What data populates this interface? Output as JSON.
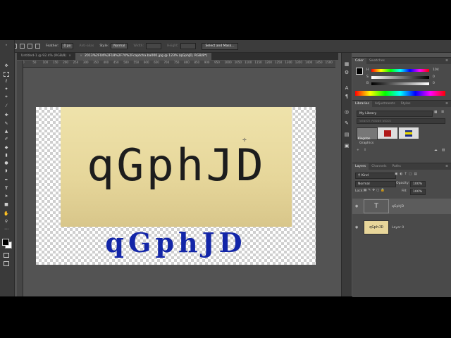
{
  "options_bar": {
    "feather_label": "Feather:",
    "feather_value": "0 px",
    "antialias_label": "Anti-alias",
    "style_label": "Style:",
    "style_value": "Normal",
    "width_label": "Width:",
    "height_label": "Height:",
    "select_mask_button": "Select and Mask..."
  },
  "tabs": [
    {
      "label": "Untitled-1 @ 92.4% (RGB/8)",
      "active": false
    },
    {
      "label": "2013%2F04%2F18%2F70%2Fcaptcha.ba000.jpg @ 123% (qGphJD, RGB/8*)",
      "active": true
    }
  ],
  "ruler": {
    "marks": [
      "0",
      "50",
      "100",
      "150",
      "200",
      "250",
      "300",
      "350",
      "400",
      "450",
      "500",
      "550",
      "600",
      "650",
      "700",
      "750",
      "800",
      "850",
      "900",
      "950",
      "1000",
      "1050",
      "1100",
      "1150",
      "1200",
      "1250",
      "1300",
      "1350",
      "1400",
      "1450",
      "1500"
    ]
  },
  "canvas": {
    "photo_text": "qGphJD",
    "typed_text": "qGphJD",
    "typed_color": "#1326a8"
  },
  "color_panel": {
    "tabs": [
      "Color",
      "Swatches"
    ],
    "h_label": "H",
    "h_value": "104",
    "s_label": "S",
    "s_value": "0",
    "b_label": "B",
    "b_value": "0"
  },
  "libraries_panel": {
    "tabs": [
      "Libraries",
      "Adjustments",
      "Styles"
    ],
    "library_select": "My Library",
    "search_placeholder": "Search Adobe Stock",
    "item_label": "Kingston",
    "graphics_label": "Graphics"
  },
  "layers_panel": {
    "tabs": [
      "Layers",
      "Channels",
      "Paths"
    ],
    "kind_label": "Kind",
    "blend_mode": "Normal",
    "opacity_label": "Opacity:",
    "opacity_value": "100%",
    "lock_label": "Lock:",
    "fill_label": "Fill:",
    "fill_value": "100%",
    "layers": [
      {
        "name": "qGphJD",
        "type": "text",
        "thumb": "T"
      },
      {
        "name": "Layer 0",
        "type": "image",
        "thumb": "qGphJD"
      }
    ]
  },
  "toolbar": {
    "tools": [
      "move-tool",
      "marquee-tool",
      "lasso-tool",
      "magic-wand-tool",
      "crop-tool",
      "eyedropper-tool",
      "healing-tool",
      "brush-tool",
      "stamp-tool",
      "history-brush-tool",
      "eraser-tool",
      "gradient-tool",
      "blur-tool",
      "dodge-tool",
      "pen-tool",
      "type-tool",
      "path-select-tool",
      "shape-tool",
      "hand-tool",
      "zoom-tool",
      "more-tool"
    ]
  }
}
